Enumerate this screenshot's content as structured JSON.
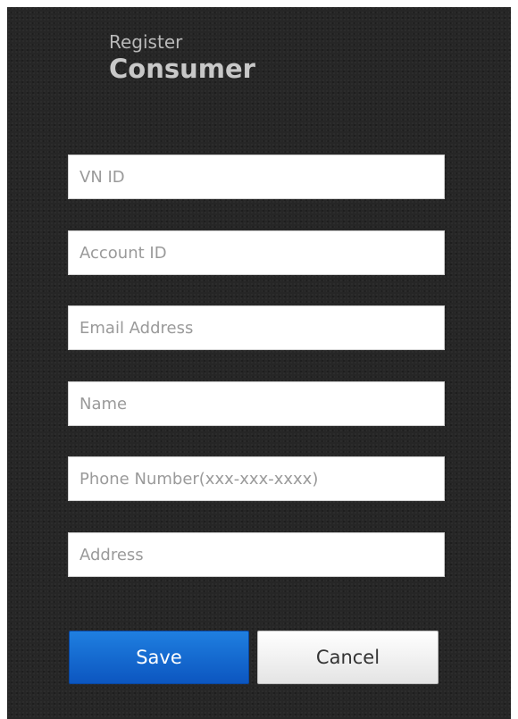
{
  "header": {
    "subtitle": "Register",
    "title": "Consumer"
  },
  "form": {
    "fields": [
      {
        "placeholder": "VN ID",
        "value": ""
      },
      {
        "placeholder": "Account ID",
        "value": ""
      },
      {
        "placeholder": "Email Address",
        "value": ""
      },
      {
        "placeholder": "Name",
        "value": ""
      },
      {
        "placeholder": "Phone Number(xxx-xxx-xxxx)",
        "value": ""
      },
      {
        "placeholder": "Address",
        "value": ""
      }
    ]
  },
  "actions": {
    "save_label": "Save",
    "cancel_label": "Cancel"
  },
  "colors": {
    "panel_bg": "#262626",
    "save_button": "#1a6fd6",
    "cancel_button": "#f2f2f2"
  }
}
